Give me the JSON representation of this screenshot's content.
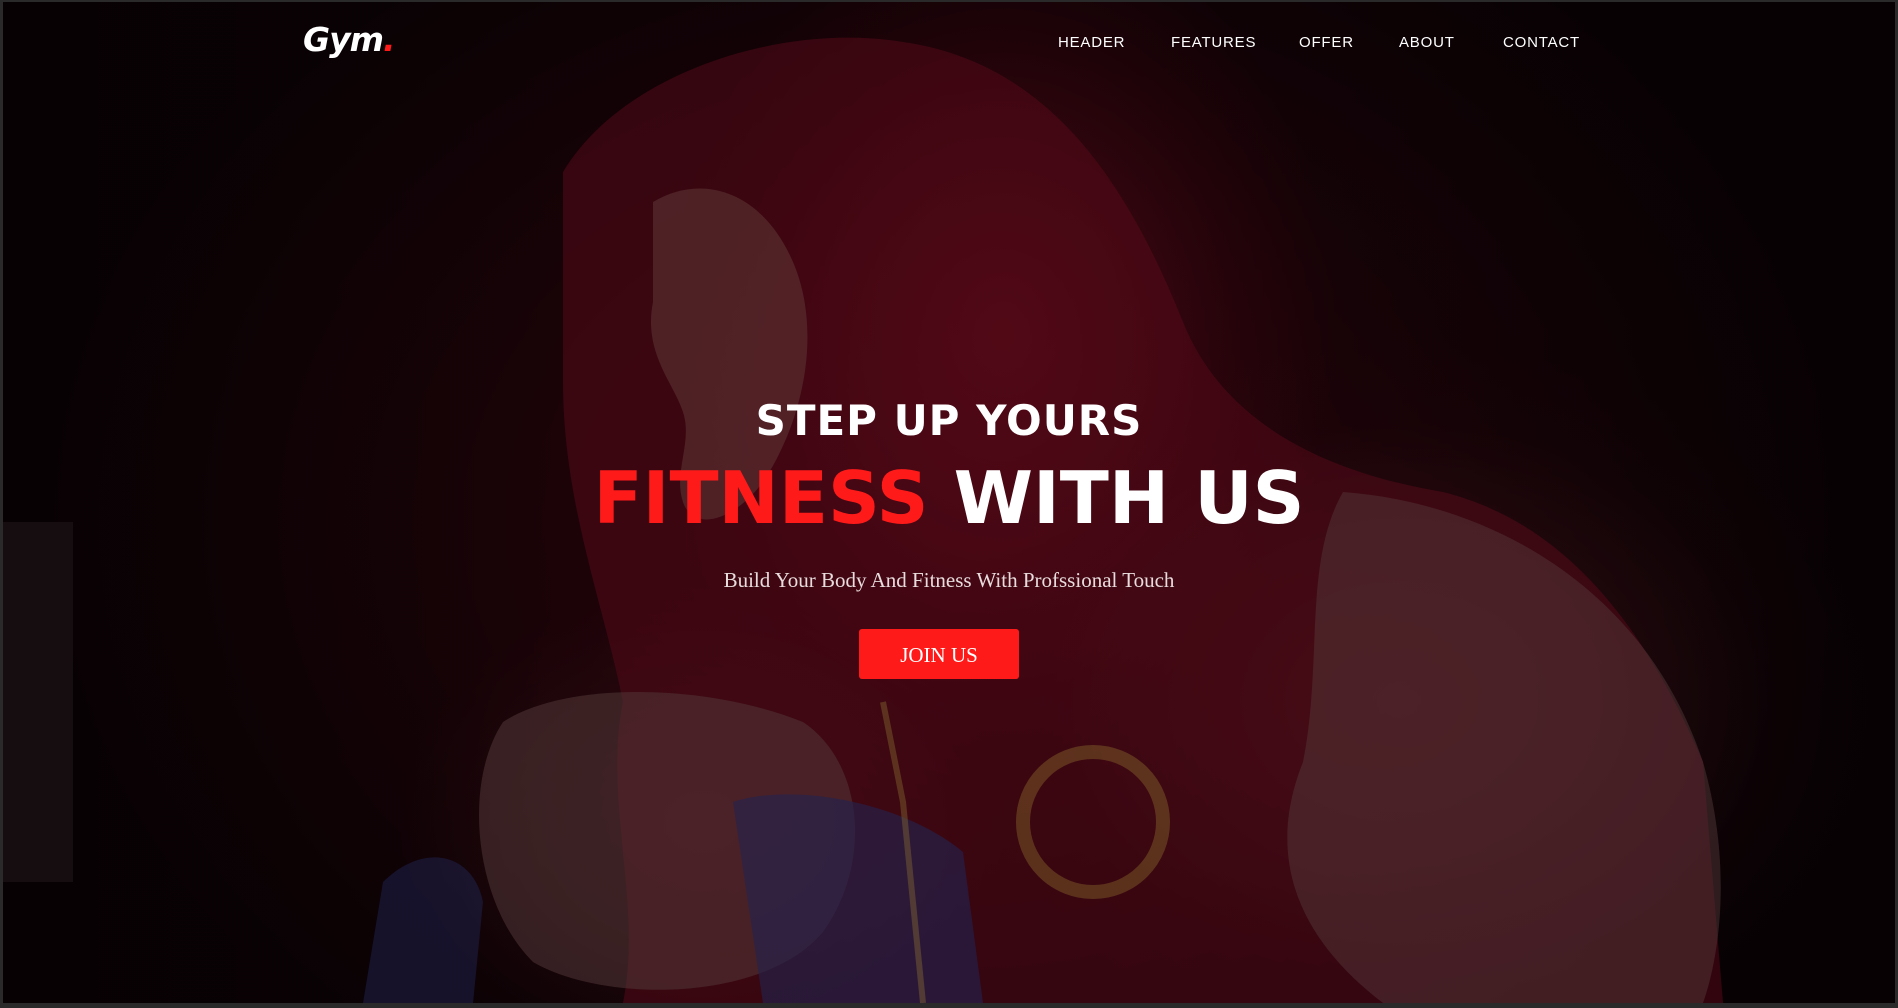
{
  "header": {
    "logo_text": "Gym",
    "logo_dot": ".",
    "nav": [
      {
        "label": "HEADER"
      },
      {
        "label": "FEATURES"
      },
      {
        "label": "OFFER"
      },
      {
        "label": "ABOUT"
      },
      {
        "label": "CONTACT"
      }
    ]
  },
  "hero": {
    "line1": "STEP UP YOURS",
    "line2_accent": "FITNESS",
    "line2_rest": "WITH US",
    "subtitle": "Build Your Body And Fitness With Profssional Touch",
    "cta_label": "JOIN US",
    "background_image": "man-in-red-hoodie-boxing-photo"
  },
  "colors": {
    "accent": "#ff1a1a",
    "text": "#ffffff",
    "overlay": "#1a0509"
  }
}
